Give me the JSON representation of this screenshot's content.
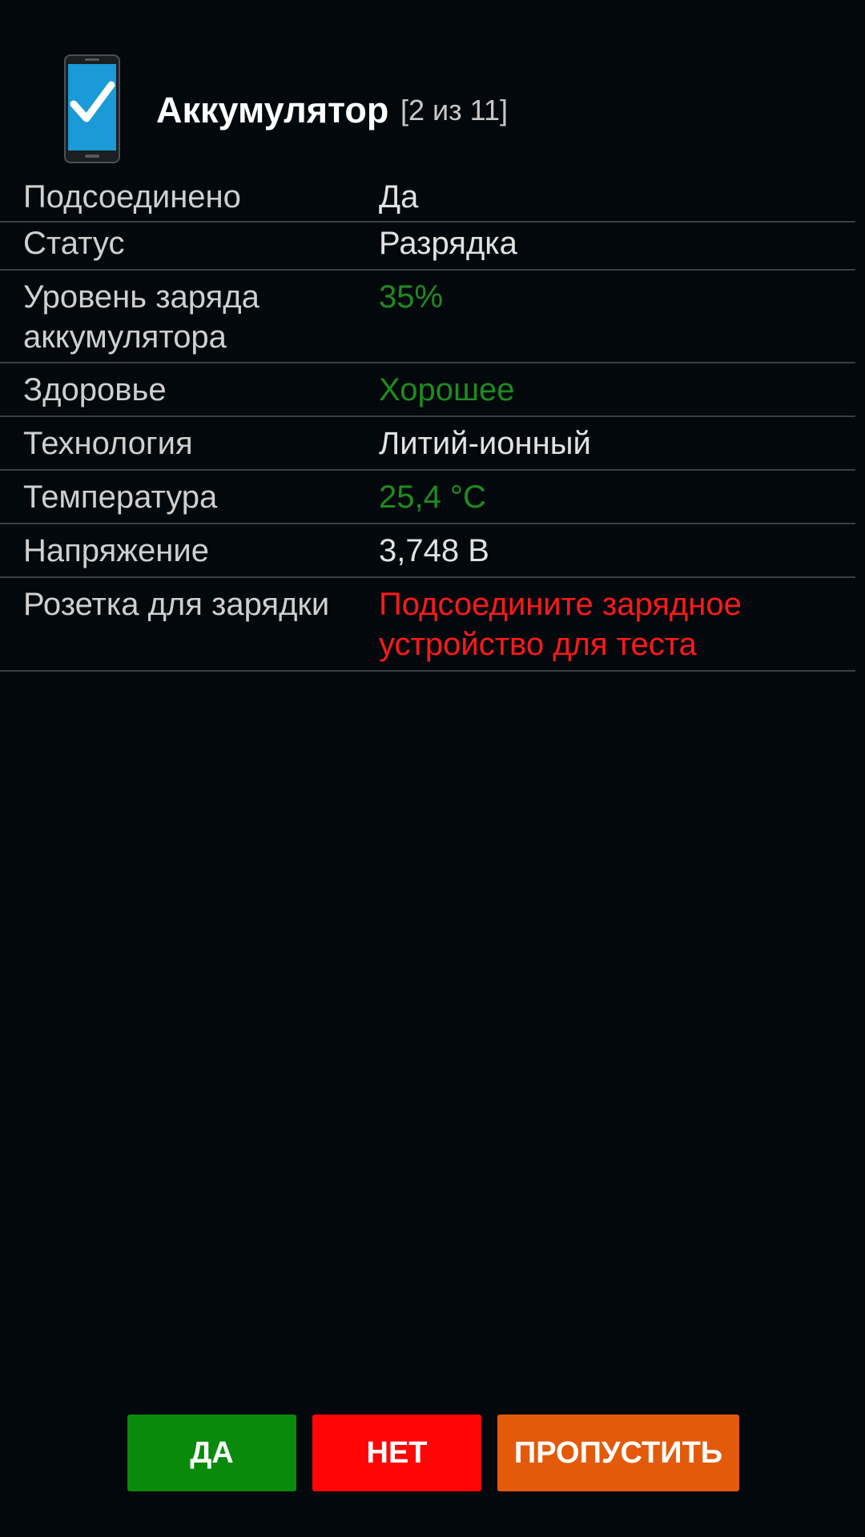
{
  "header": {
    "icon": "phone-checkmark-icon",
    "title": "Аккумулятор",
    "counter": "[2 из 11]"
  },
  "rows": [
    {
      "label": "Подсоединено",
      "value": "Да",
      "status": "normal"
    },
    {
      "label": "Статус",
      "value": "Разрядка",
      "status": "normal"
    },
    {
      "label": "Уровень заряда аккумулятора",
      "value": "35%",
      "status": "good"
    },
    {
      "label": "Здоровье",
      "value": "Хорошее",
      "status": "good"
    },
    {
      "label": "Технология",
      "value": "Литий-ионный",
      "status": "normal"
    },
    {
      "label": "Температура",
      "value": "25,4 °C",
      "status": "good"
    },
    {
      "label": "Напряжение",
      "value": "3,748 В",
      "status": "normal"
    },
    {
      "label": "Розетка для зарядки",
      "value": "Подсоедините зарядное устройство для теста",
      "status": "error"
    }
  ],
  "buttons": {
    "yes": "ДА",
    "no": "НЕТ",
    "skip": "ПРОПУСТИТЬ"
  },
  "colors": {
    "background": "#03080c",
    "good": "#1e8c1e",
    "error": "#ff1a1a",
    "yes_button": "#0a8a0a",
    "no_button": "#ff0505",
    "skip_button": "#e35a0a"
  }
}
